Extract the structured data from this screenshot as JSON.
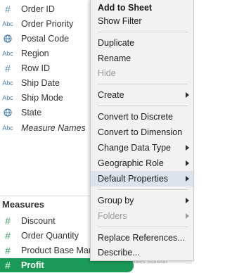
{
  "dimensions": [
    {
      "icon": "hash-icon",
      "glyph": "#",
      "label": "Order ID"
    },
    {
      "icon": "abc-icon",
      "glyph": "Abc",
      "label": "Order Priority"
    },
    {
      "icon": "globe-icon",
      "glyph": "",
      "label": "Postal Code"
    },
    {
      "icon": "abc-icon",
      "glyph": "Abc",
      "label": "Region"
    },
    {
      "icon": "hash-icon",
      "glyph": "#",
      "label": "Row ID"
    },
    {
      "icon": "abc-icon",
      "glyph": "Abc",
      "label": "Ship Date"
    },
    {
      "icon": "abc-icon",
      "glyph": "Abc",
      "label": "Ship Mode"
    },
    {
      "icon": "globe-icon",
      "glyph": "",
      "label": "State"
    },
    {
      "icon": "abc-icon",
      "glyph": "Abc",
      "label": "Measure Names"
    }
  ],
  "measures_header": "Measures",
  "measures": [
    {
      "icon": "hash-icon",
      "glyph": "#",
      "label": "Discount"
    },
    {
      "icon": "hash-icon",
      "glyph": "#",
      "label": "Order Quantity"
    },
    {
      "icon": "hash-icon",
      "glyph": "#",
      "label": "Product Base Margin"
    },
    {
      "icon": "hash-icon",
      "glyph": "#",
      "label": "Profit"
    }
  ],
  "selected_measure": "Profit",
  "watermark": "Sales Subtotal",
  "menu": {
    "add_to_sheet": "Add to Sheet",
    "show_filter": "Show Filter",
    "duplicate": "Duplicate",
    "rename": "Rename",
    "hide": "Hide",
    "create": "Create",
    "convert_to_discrete": "Convert to Discrete",
    "convert_to_dimension": "Convert to Dimension",
    "change_data_type": "Change Data Type",
    "geographic_role": "Geographic Role",
    "default_properties": "Default Properties",
    "group_by": "Group by",
    "folders": "Folders",
    "replace_references": "Replace References...",
    "describe": "Describe..."
  },
  "colors": {
    "selected_pill": "#1a9a57",
    "menu_background": "#f2f2f2",
    "menu_highlight": "#dde3ec"
  }
}
